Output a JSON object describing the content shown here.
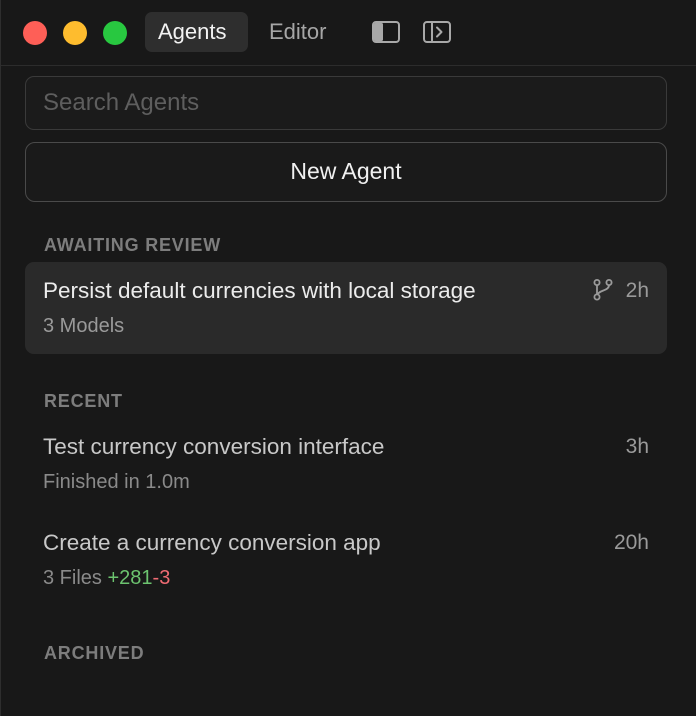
{
  "titlebar": {
    "tabs": [
      {
        "label": "Agents",
        "active": true
      },
      {
        "label": "Editor",
        "active": false
      }
    ],
    "icons": [
      "sidebar-toggle-icon",
      "panel-toggle-icon"
    ],
    "traffic_colors": {
      "close": "#fe5f57",
      "minimize": "#febc2e",
      "maximize": "#28c840"
    }
  },
  "search": {
    "placeholder": "Search Agents",
    "value": ""
  },
  "new_agent": {
    "label": "New Agent"
  },
  "sections": {
    "awaiting_review": {
      "label": "AWAITING REVIEW",
      "items": [
        {
          "title": "Persist default currencies with local storage",
          "subtitle": "3 Models",
          "time": "2h",
          "icon": "git-branch-icon"
        }
      ]
    },
    "recent": {
      "label": "RECENT",
      "items": [
        {
          "title": "Test currency conversion interface",
          "subtitle": "Finished in 1.0m",
          "time": "3h"
        },
        {
          "title": "Create a currency conversion app",
          "files": "3 Files",
          "additions": "+281",
          "deletions": "-3",
          "time": "20h"
        }
      ]
    },
    "archived": {
      "label": "ARCHIVED"
    }
  },
  "colors": {
    "background": "#181818",
    "highlight": "#2a2a2a",
    "additions": "#6cc36f",
    "deletions": "#ef6b73"
  }
}
